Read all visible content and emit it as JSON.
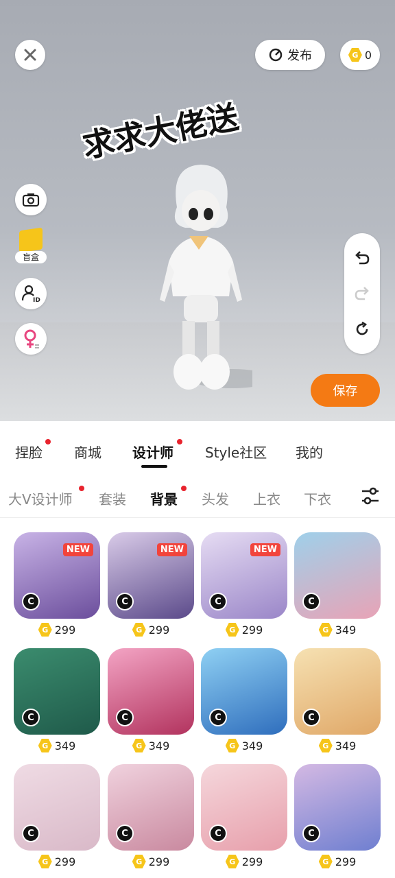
{
  "top": {
    "publish_label": "发布",
    "coin_count": "0",
    "caption": "求求大佬送"
  },
  "left_tools": {
    "blind_box_label": "盲盒"
  },
  "save_label": "保存",
  "main_tabs": [
    {
      "label": "捏脸",
      "dot": true
    },
    {
      "label": "商城",
      "dot": false
    },
    {
      "label": "设计师",
      "dot": true,
      "active": true
    },
    {
      "label": "Style社区",
      "dot": false
    },
    {
      "label": "我的",
      "dot": false
    }
  ],
  "sub_tabs": [
    {
      "label": "大V设计师",
      "dot": true
    },
    {
      "label": "套装",
      "dot": false
    },
    {
      "label": "背景",
      "dot": true,
      "active": true
    },
    {
      "label": "头发",
      "dot": false
    },
    {
      "label": "上衣",
      "dot": false
    },
    {
      "label": "下衣",
      "dot": false
    }
  ],
  "items": [
    {
      "price": "299",
      "new": true,
      "new_label": "NEW",
      "colors": [
        "#6b4e9c",
        "#c8b3e6"
      ]
    },
    {
      "price": "299",
      "new": true,
      "new_label": "NEW",
      "colors": [
        "#5b4a8a",
        "#d9cbe8"
      ]
    },
    {
      "price": "299",
      "new": true,
      "new_label": "NEW",
      "colors": [
        "#9a86c8",
        "#e6dcf3"
      ]
    },
    {
      "price": "349",
      "new": false,
      "colors": [
        "#e8a3b6",
        "#9fd0ea"
      ]
    },
    {
      "price": "349",
      "new": false,
      "colors": [
        "#1f5a4a",
        "#3b8c6e"
      ]
    },
    {
      "price": "349",
      "new": false,
      "colors": [
        "#b2335e",
        "#f3a4c4"
      ]
    },
    {
      "price": "349",
      "new": false,
      "colors": [
        "#2f6ebd",
        "#8fd0f3"
      ]
    },
    {
      "price": "349",
      "new": false,
      "colors": [
        "#e0a868",
        "#f6e1b2"
      ]
    },
    {
      "price": "299",
      "new": false,
      "colors": [
        "#d9b9c8",
        "#efdbe4"
      ]
    },
    {
      "price": "299",
      "new": false,
      "colors": [
        "#c9899f",
        "#f0d2de"
      ]
    },
    {
      "price": "299",
      "new": false,
      "colors": [
        "#e79fab",
        "#f5d7dc"
      ]
    },
    {
      "price": "299",
      "new": false,
      "colors": [
        "#6f7fd0",
        "#d4b9e3"
      ]
    }
  ],
  "coin_letter": "G",
  "creator_letter": "C",
  "colors": {
    "accent": "#f47a14",
    "red_dot": "#e8232d",
    "coin": "#f6c51a"
  }
}
